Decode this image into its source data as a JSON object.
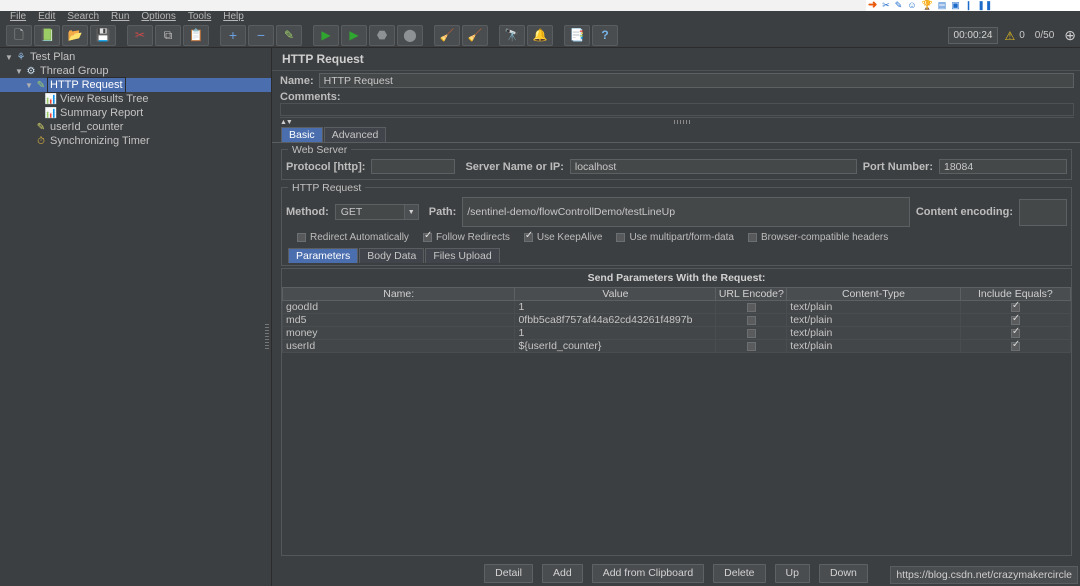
{
  "window": {
    "title": "HTTP Request"
  },
  "browser_strip": {
    "icons": [
      "swoosh-icon",
      "scissors-icon",
      "pen-icon",
      "smiley-icon",
      "trophy-icon",
      "card-icon",
      "tag-icon",
      "bookmark-icon",
      "bars-icon"
    ]
  },
  "menubar": {
    "items": [
      {
        "label": "File",
        "mnemonic": "F"
      },
      {
        "label": "Edit",
        "mnemonic": "E"
      },
      {
        "label": "Search",
        "mnemonic": "S"
      },
      {
        "label": "Run",
        "mnemonic": "R"
      },
      {
        "label": "Options",
        "mnemonic": "O"
      },
      {
        "label": "Tools",
        "mnemonic": "T"
      },
      {
        "label": "Help",
        "mnemonic": "H"
      }
    ]
  },
  "toolbar": {
    "buttons": [
      {
        "name": "new-button",
        "icon": "new-document-icon",
        "glyph": "🗋"
      },
      {
        "name": "templates-button",
        "icon": "templates-icon",
        "glyph": "📗"
      },
      {
        "name": "open-button",
        "icon": "open-folder-icon",
        "glyph": "📂"
      },
      {
        "name": "save-button",
        "icon": "save-disk-icon",
        "glyph": "💾"
      },
      {
        "name": "cut-button",
        "icon": "scissors-icon",
        "glyph": "✂"
      },
      {
        "name": "copy-button",
        "icon": "copy-icon",
        "glyph": "⧉"
      },
      {
        "name": "paste-button",
        "icon": "clipboard-icon",
        "glyph": "📋"
      },
      {
        "name": "expand-all-button",
        "icon": "plus-icon",
        "glyph": "+"
      },
      {
        "name": "collapse-all-button",
        "icon": "minus-icon",
        "glyph": "−"
      },
      {
        "name": "toggle-button",
        "icon": "toggle-pencil-icon",
        "glyph": "✎"
      },
      {
        "name": "start-button",
        "icon": "play-icon",
        "glyph": "▶"
      },
      {
        "name": "start-no-pauses-button",
        "icon": "play-no-pause-icon",
        "glyph": "▶"
      },
      {
        "name": "stop-button",
        "icon": "stop-icon",
        "glyph": "⬣"
      },
      {
        "name": "shutdown-button",
        "icon": "shutdown-icon",
        "glyph": "⬤"
      },
      {
        "name": "clear-button",
        "icon": "clear-broom-icon",
        "glyph": "🧹"
      },
      {
        "name": "clear-all-button",
        "icon": "clear-all-broom-icon",
        "glyph": "🧹"
      },
      {
        "name": "search-button",
        "icon": "binoculars-icon",
        "glyph": "🔭"
      },
      {
        "name": "reset-search-button",
        "icon": "bell-icon",
        "glyph": "🔔"
      },
      {
        "name": "function-helper-button",
        "icon": "function-list-icon",
        "glyph": "📑"
      },
      {
        "name": "help-button",
        "icon": "help-question-icon",
        "glyph": "?"
      }
    ],
    "status": {
      "elapsed_time": "00:00:24",
      "warning_icon": "warning-triangle-icon",
      "warning_count": "0",
      "threads": "0/50",
      "remote_icon": "remote-globe-icon"
    }
  },
  "tree": {
    "nodes": [
      {
        "label": "Test Plan",
        "icon": "test-plan-icon",
        "glyph": "⚘",
        "indent": 0,
        "toggle": "▼",
        "selected": false
      },
      {
        "label": "Thread Group",
        "icon": "thread-group-icon",
        "glyph": "⚙",
        "indent": 1,
        "toggle": "▼",
        "selected": false
      },
      {
        "label": "HTTP Request",
        "icon": "http-request-icon",
        "glyph": "✎",
        "indent": 2,
        "toggle": "▼",
        "selected": true
      },
      {
        "label": "View Results Tree",
        "icon": "view-results-tree-icon",
        "glyph": "📊",
        "indent": 3,
        "toggle": "",
        "selected": false
      },
      {
        "label": "Summary Report",
        "icon": "summary-report-icon",
        "glyph": "📊",
        "indent": 3,
        "toggle": "",
        "selected": false
      },
      {
        "label": "userId_counter",
        "icon": "counter-icon",
        "glyph": "✎",
        "indent": 2,
        "toggle": "",
        "selected": false
      },
      {
        "label": "Synchronizing Timer",
        "icon": "timer-clock-icon",
        "glyph": "⏱",
        "indent": 2,
        "toggle": "",
        "selected": false
      }
    ]
  },
  "panel": {
    "title": "HTTP Request",
    "name_label": "Name:",
    "name_value": "HTTP Request",
    "comments_label": "Comments:",
    "comments_value": "",
    "tabs": [
      {
        "label": "Basic",
        "active": true
      },
      {
        "label": "Advanced",
        "active": false
      }
    ],
    "web_server": {
      "group_title": "Web Server",
      "protocol_label": "Protocol [http]:",
      "protocol_value": "",
      "server_label": "Server Name or IP:",
      "server_value": "localhost",
      "port_label": "Port Number:",
      "port_value": "18084"
    },
    "http_request": {
      "group_title": "HTTP Request",
      "method_label": "Method:",
      "method_value": "GET",
      "path_label": "Path:",
      "path_value": "/sentinel-demo/flowControllDemo/testLineUp",
      "content_encoding_label": "Content encoding:",
      "content_encoding_value": "",
      "options": [
        {
          "label": "Redirect Automatically",
          "checked": false
        },
        {
          "label": "Follow Redirects",
          "checked": true
        },
        {
          "label": "Use KeepAlive",
          "checked": true
        },
        {
          "label": "Use multipart/form-data",
          "checked": false
        },
        {
          "label": "Browser-compatible headers",
          "checked": false
        }
      ]
    },
    "param_tabs": [
      {
        "label": "Parameters",
        "active": true
      },
      {
        "label": "Body Data",
        "active": false
      },
      {
        "label": "Files Upload",
        "active": false
      }
    ],
    "parameters": {
      "heading": "Send Parameters With the Request:",
      "columns": [
        "Name:",
        "Value",
        "URL Encode?",
        "Content-Type",
        "Include Equals?"
      ],
      "rows": [
        {
          "name": "goodId",
          "value": "1",
          "url_encode": false,
          "content_type": "text/plain",
          "include_equals": true
        },
        {
          "name": "md5",
          "value": "0fbb5ca8f757af44a62cd43261f4897b",
          "url_encode": false,
          "content_type": "text/plain",
          "include_equals": true
        },
        {
          "name": "money",
          "value": "1",
          "url_encode": false,
          "content_type": "text/plain",
          "include_equals": true
        },
        {
          "name": "userId",
          "value": "${userId_counter}",
          "url_encode": false,
          "content_type": "text/plain",
          "include_equals": true
        }
      ]
    },
    "buttons": [
      {
        "label": "Detail"
      },
      {
        "label": "Add"
      },
      {
        "label": "Add from Clipboard"
      },
      {
        "label": "Delete"
      },
      {
        "label": "Up"
      },
      {
        "label": "Down"
      }
    ]
  },
  "watermark": {
    "text": "https://blog.csdn.net/crazymakercircle"
  },
  "colors": {
    "background": "#3c3f41",
    "selection": "#4b6eaf",
    "field": "#454849",
    "border": "#5d6062",
    "text": "#c4c4c4"
  }
}
